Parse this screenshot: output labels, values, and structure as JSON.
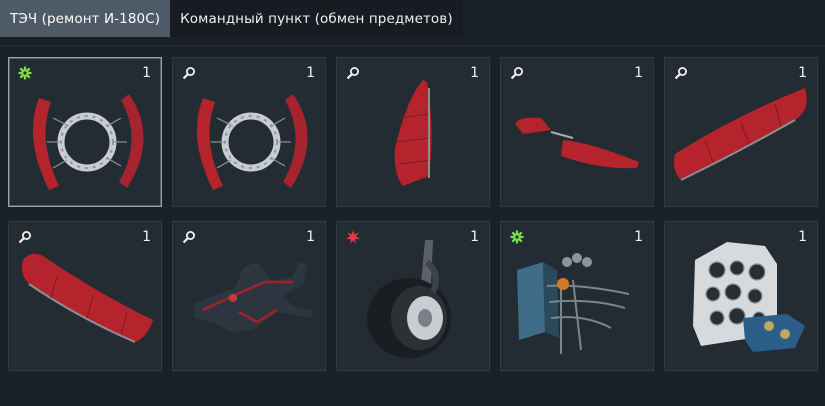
{
  "tabs": [
    {
      "label": "ТЭЧ (ремонт И-180С)",
      "active": true
    },
    {
      "label": "Командный пункт (обмен предметов)",
      "active": false
    }
  ],
  "items": [
    {
      "name": "engine-cowling-ring",
      "badge": "gear-icon",
      "count": "1",
      "selected": true
    },
    {
      "name": "engine-cowling-ring",
      "badge": "magnifier-icon",
      "count": "1",
      "selected": false
    },
    {
      "name": "rudder-part",
      "badge": "magnifier-icon",
      "count": "1",
      "selected": false
    },
    {
      "name": "horizontal-stabilizer",
      "badge": "magnifier-icon",
      "count": "1",
      "selected": false
    },
    {
      "name": "right-wing",
      "badge": "magnifier-icon",
      "count": "1",
      "selected": false
    },
    {
      "name": "left-wing",
      "badge": "magnifier-icon",
      "count": "1",
      "selected": false
    },
    {
      "name": "airframe-silhouette",
      "badge": "magnifier-icon",
      "count": "1",
      "selected": false
    },
    {
      "name": "landing-gear-wheel",
      "badge": "burst-icon",
      "count": "1",
      "selected": false
    },
    {
      "name": "engine-controls-assembly",
      "badge": "gear-icon",
      "count": "1",
      "selected": false
    },
    {
      "name": "instrument-panel",
      "badge": "",
      "count": "1",
      "selected": false
    }
  ],
  "colors": {
    "gear_badge": "#7cdc4a",
    "burst_badge": "#e8394a",
    "magnifier_badge": "#f0f0f0",
    "part_red": "#b5242c"
  }
}
